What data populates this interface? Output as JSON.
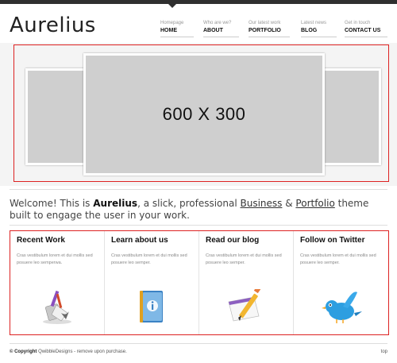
{
  "brand": {
    "logo": "Aurelius"
  },
  "nav": [
    {
      "sub": "Homepage",
      "label": "HOME"
    },
    {
      "sub": "Who are we?",
      "label": "ABOUT"
    },
    {
      "sub": "Our latest work",
      "label": "PORTFOLIO"
    },
    {
      "sub": "Latest news",
      "label": "BLOG"
    },
    {
      "sub": "Get in touch",
      "label": "CONTACT US"
    }
  ],
  "slider": {
    "main_text": "600 X 300"
  },
  "welcome": {
    "lead": "Welcome! This is ",
    "brand": "Aurelius",
    "mid": ", a slick, professional ",
    "link1": "Business",
    "amp": " & ",
    "link2": "Portfolio",
    "tail": " theme built to engage the user in your work."
  },
  "features": [
    {
      "title": "Recent Work",
      "text": "Cras vestibulum lorem et dui mollis sed posuere leo semperwa.",
      "icon": "paint-brush-icon"
    },
    {
      "title": "Learn about us",
      "text": "Cras vestibulum lorem et dui mollis sed posuere leo semper.",
      "icon": "info-book-icon"
    },
    {
      "title": "Read our blog",
      "text": "Cras vestibulum lorem et dui mollis sed posuere leo semper.",
      "icon": "pencil-note-icon"
    },
    {
      "title": "Follow on Twitter",
      "text": "Cras vestibulum lorem et dui mollis sed posuere leo semper.",
      "icon": "twitter-bird-icon"
    }
  ],
  "footer": {
    "copyright_label": "© Copyright",
    "copyright_text": " QwibbleDesigns - remove upon purchase.",
    "top_link": "top"
  },
  "colors": {
    "highlight_border": "#dd2222",
    "twitter_blue": "#2d9ee0"
  }
}
